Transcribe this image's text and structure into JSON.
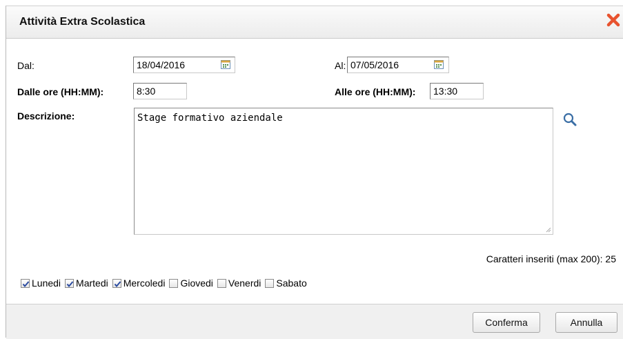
{
  "dialog": {
    "title": "Attività Extra Scolastica",
    "close_icon": "close-x-icon"
  },
  "form": {
    "from_label": "Dal:",
    "from_value": "18/04/2016",
    "to_label": "Al:",
    "to_value": "07/05/2016",
    "start_time_label": "Dalle ore (HH:MM):",
    "start_time_value": "8:30",
    "end_time_label": "Alle ore (HH:MM):",
    "end_time_value": "13:30",
    "description_label": "Descrizione:",
    "description_value": "Stage formativo aziendale",
    "counter_text": "Caratteri inseriti (max 200): 25"
  },
  "days": [
    {
      "label": "Lunedi",
      "checked": true
    },
    {
      "label": "Martedi",
      "checked": true
    },
    {
      "label": "Mercoledi",
      "checked": true
    },
    {
      "label": "Giovedi",
      "checked": false
    },
    {
      "label": "Venerdi",
      "checked": false
    },
    {
      "label": "Sabato",
      "checked": false
    }
  ],
  "buttons": {
    "confirm": "Conferma",
    "cancel": "Annulla"
  },
  "colors": {
    "close": "#e8532f",
    "search": "#3a6ea5",
    "check": "#2a4aa0"
  }
}
